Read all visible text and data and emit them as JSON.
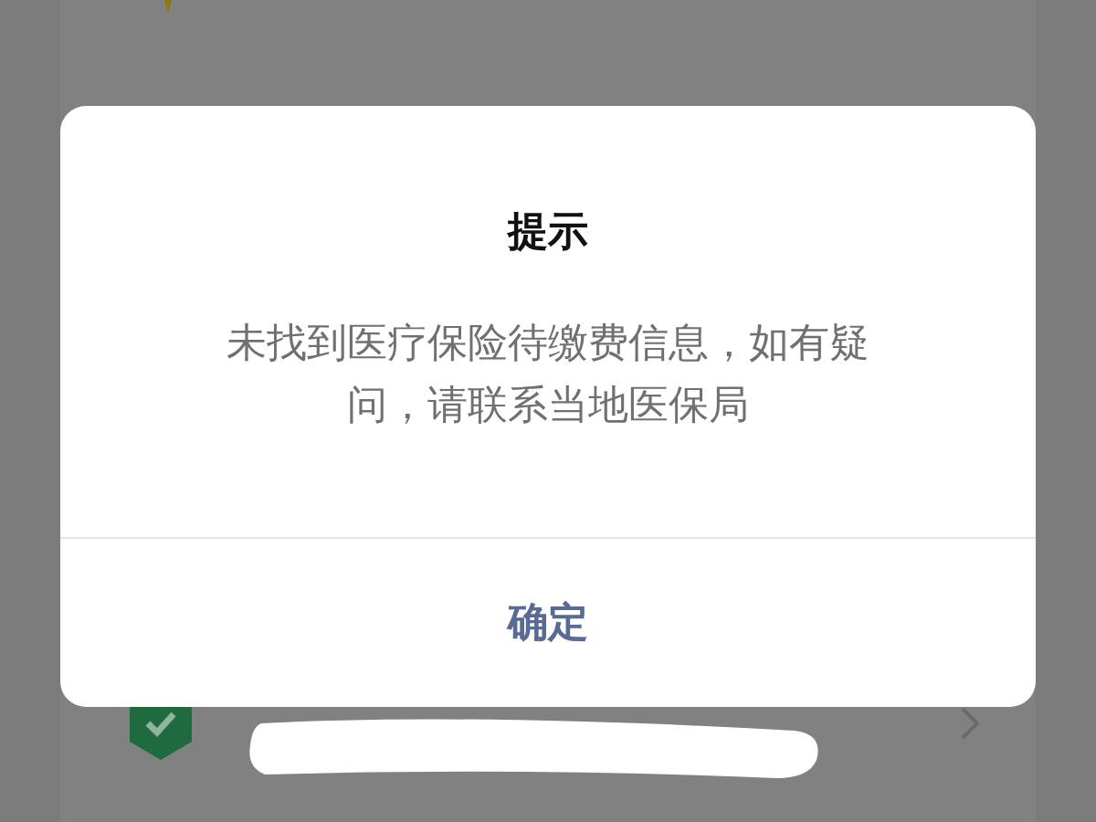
{
  "dialog": {
    "title": "提示",
    "message": "未找到医疗保险待缴费信息，如有疑问，请联系当地医保局",
    "buttons": [
      "确定"
    ]
  }
}
